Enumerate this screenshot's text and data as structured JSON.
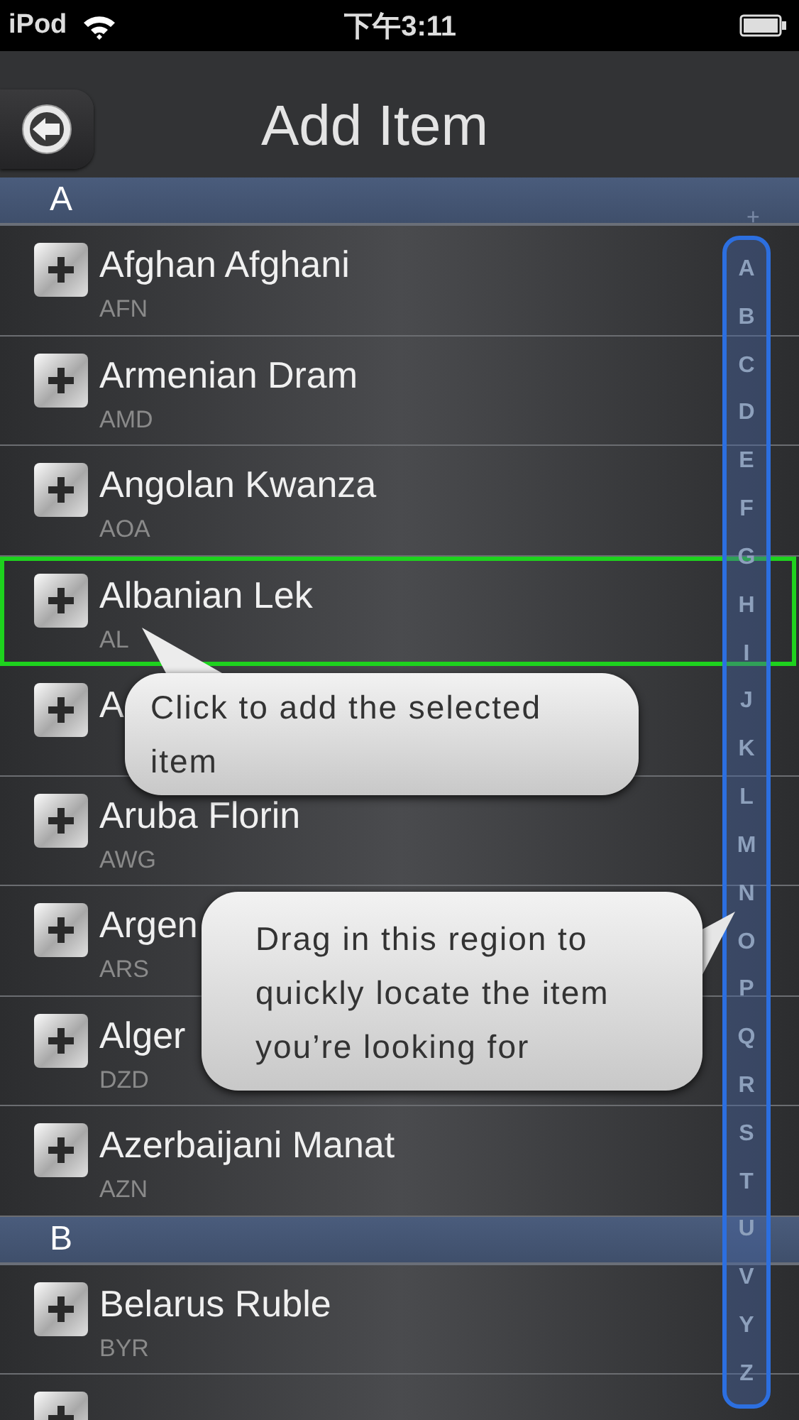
{
  "status_bar": {
    "carrier": "iPod",
    "time": "下午3:11"
  },
  "header": {
    "title": "Add Item"
  },
  "sections": [
    {
      "letter": "A",
      "items": [
        {
          "name": "Afghan Afghani",
          "code": "AFN",
          "selected": false
        },
        {
          "name": "Armenian Dram",
          "code": "AMD",
          "selected": false
        },
        {
          "name": "Angolan Kwanza",
          "code": "AOA",
          "selected": false
        },
        {
          "name": "Albanian Lek",
          "code": "AL",
          "selected": true
        },
        {
          "name": "A",
          "selected": false
        },
        {
          "name": "Aruba Florin",
          "code": "AWG",
          "selected": false
        },
        {
          "name": "Argen",
          "code": "ARS",
          "selected": false
        },
        {
          "name": "Alger",
          "code": "DZD",
          "selected": false
        },
        {
          "name": "Azerbaijani Manat",
          "code": "AZN",
          "selected": false
        }
      ]
    },
    {
      "letter": "B",
      "items": [
        {
          "name": "Belarus Ruble",
          "code": "BYR",
          "selected": false
        },
        {
          "selected": false
        }
      ]
    }
  ],
  "index": {
    "top": "+",
    "letters": [
      "A",
      "B",
      "C",
      "D",
      "E",
      "F",
      "G",
      "H",
      "I",
      "J",
      "K",
      "L",
      "M",
      "N",
      "O",
      "P",
      "Q",
      "R",
      "S",
      "T",
      "U",
      "V",
      "Y",
      "Z"
    ]
  },
  "tooltips": [
    {
      "text": "Click to add the selected item",
      "kind": "left"
    },
    {
      "text": "Drag in this region to quickly locate the item you’re looking for",
      "kind": "right"
    }
  ]
}
